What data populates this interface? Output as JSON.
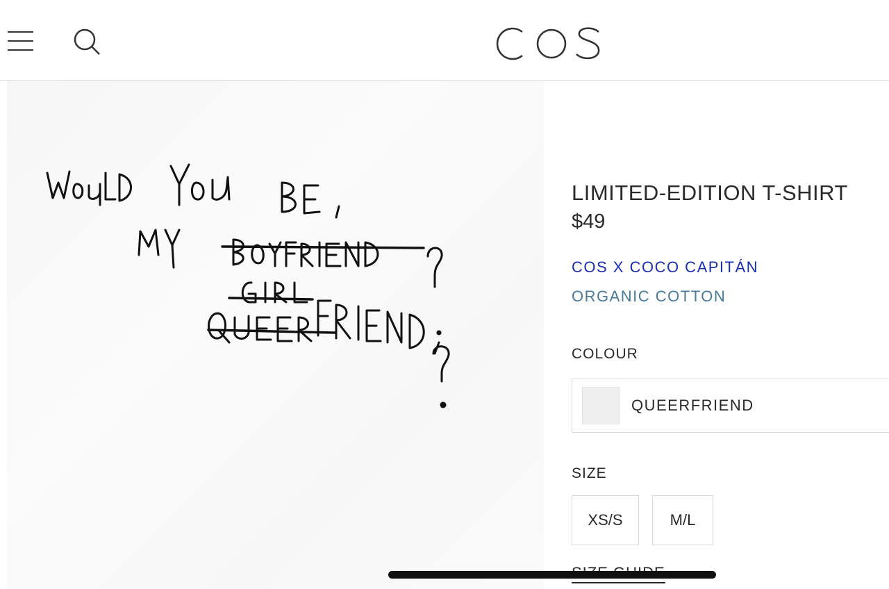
{
  "header": {
    "brand": "COS",
    "menu_icon": "hamburger-menu-icon",
    "search_icon": "search-icon"
  },
  "product_image": {
    "print_text_lines": [
      "WOULD YOU BE,",
      "MY BOYFRIEND?",
      "GIRL",
      "QUEER FRIEND?",
      "?"
    ]
  },
  "product": {
    "title": "LIMITED-EDITION T-SHIRT",
    "price": "$49",
    "collab_link": "COS X COCO CAPITÁN",
    "material_link": "ORGANIC COTTON",
    "colour_label": "COLOUR",
    "colour_value": "QUEERFRIEND",
    "swatch_color": "#efefef",
    "size_label": "SIZE",
    "sizes": [
      "XS/S",
      "M/L"
    ],
    "size_guide": "SIZE GUIDE"
  },
  "colors": {
    "collab_link": "#1a2fb0",
    "material_link": "#4a7a9a",
    "text": "#2a2a2a"
  }
}
